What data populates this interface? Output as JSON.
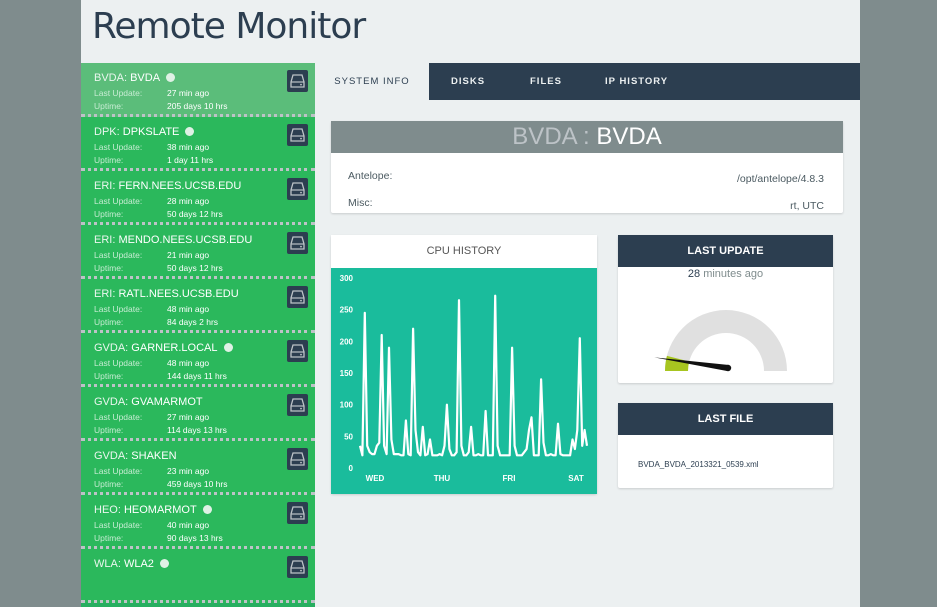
{
  "app": {
    "title": "Remote Monitor"
  },
  "stations": [
    {
      "net": "BVDA:",
      "sta": "BVDA",
      "globe": true,
      "last_update_label": "Last Update:",
      "last_update": "27 min ago",
      "uptime_label": "Uptime:",
      "uptime": "205 days 10 hrs",
      "active": true
    },
    {
      "net": "DPK:",
      "sta": "DPKSLATE",
      "globe": true,
      "last_update_label": "Last Update:",
      "last_update": "38 min ago",
      "uptime_label": "Uptime:",
      "uptime": "1 day 11 hrs"
    },
    {
      "net": "ERI:",
      "sta": "FERN.NEES.UCSB.EDU",
      "globe": false,
      "last_update_label": "Last Update:",
      "last_update": "28 min ago",
      "uptime_label": "Uptime:",
      "uptime": "50 days 12 hrs"
    },
    {
      "net": "ERI:",
      "sta": "MENDO.NEES.UCSB.EDU",
      "globe": false,
      "last_update_label": "Last Update:",
      "last_update": "21 min ago",
      "uptime_label": "Uptime:",
      "uptime": "50 days 12 hrs"
    },
    {
      "net": "ERI:",
      "sta": "RATL.NEES.UCSB.EDU",
      "globe": false,
      "last_update_label": "Last Update:",
      "last_update": "48 min ago",
      "uptime_label": "Uptime:",
      "uptime": "84 days 2 hrs"
    },
    {
      "net": "GVDA:",
      "sta": "GARNER.LOCAL",
      "globe": true,
      "last_update_label": "Last Update:",
      "last_update": "48 min ago",
      "uptime_label": "Uptime:",
      "uptime": "144 days 11 hrs"
    },
    {
      "net": "GVDA:",
      "sta": "GVAMARMOT",
      "globe": false,
      "last_update_label": "Last Update:",
      "last_update": "27 min ago",
      "uptime_label": "Uptime:",
      "uptime": "114 days 13 hrs"
    },
    {
      "net": "GVDA:",
      "sta": "SHAKEN",
      "globe": false,
      "last_update_label": "Last Update:",
      "last_update": "23 min ago",
      "uptime_label": "Uptime:",
      "uptime": "459 days 10 hrs"
    },
    {
      "net": "HEO:",
      "sta": "HEOMARMOT",
      "globe": true,
      "last_update_label": "Last Update:",
      "last_update": "40 min ago",
      "uptime_label": "Uptime:",
      "uptime": "90 days 13 hrs"
    },
    {
      "net": "WLA:",
      "sta": "WLA2",
      "globe": true,
      "last_update_label": "",
      "last_update": "",
      "uptime_label": "",
      "uptime": ""
    }
  ],
  "tabs": [
    {
      "label": "SYSTEM INFO",
      "active": true
    },
    {
      "label": "DISKS"
    },
    {
      "label": "FILES"
    },
    {
      "label": "IP HISTORY"
    }
  ],
  "system_info": {
    "title_net": "BVDA :",
    "title_sta": "BVDA",
    "rows": [
      {
        "label": "Antelope:",
        "value": "/opt/antelope/4.8.3"
      },
      {
        "label": "Misc:",
        "value": "rt, UTC"
      }
    ]
  },
  "cpu_history": {
    "title": "CPU HISTORY"
  },
  "last_update": {
    "title": "LAST UPDATE",
    "value": "28",
    "unit": "minutes ago",
    "gauge_fraction": 0.08
  },
  "last_file": {
    "title": "LAST FILE",
    "filename": "BVDA_BVDA_2013321_0539.xml"
  },
  "colors": {
    "green": "#27ae60",
    "dark": "#2c3e50",
    "teal": "#1abc9c",
    "gauge": "#a7c520",
    "gray": "#7f8c8d"
  },
  "chart_data": {
    "type": "line",
    "title": "CPU HISTORY",
    "x_ticks": [
      "WED",
      "THU",
      "FRI",
      "SAT"
    ],
    "ylim": [
      0,
      300
    ],
    "y_ticks": [
      0,
      50,
      100,
      150,
      200,
      250,
      300
    ],
    "series": [
      {
        "values": [
          35,
          20,
          245,
          35,
          25,
          22,
          22,
          35,
          40,
          210,
          35,
          22,
          190,
          45,
          22,
          22,
          22,
          20,
          20,
          75,
          22,
          20,
          220,
          60,
          25,
          20,
          65,
          20,
          22,
          45,
          20,
          20,
          20,
          22,
          20,
          35,
          100,
          30,
          20,
          20,
          25,
          265,
          35,
          20,
          20,
          25,
          65,
          20,
          20,
          22,
          20,
          20,
          90,
          20,
          20,
          20,
          272,
          35,
          20,
          20,
          20,
          20,
          20,
          190,
          35,
          20,
          20,
          20,
          25,
          30,
          60,
          80,
          20,
          20,
          20,
          140,
          40,
          20,
          20,
          22,
          20,
          20,
          70,
          22,
          20,
          20,
          20,
          20,
          45,
          30,
          60,
          205,
          35,
          60,
          35
        ]
      }
    ]
  }
}
